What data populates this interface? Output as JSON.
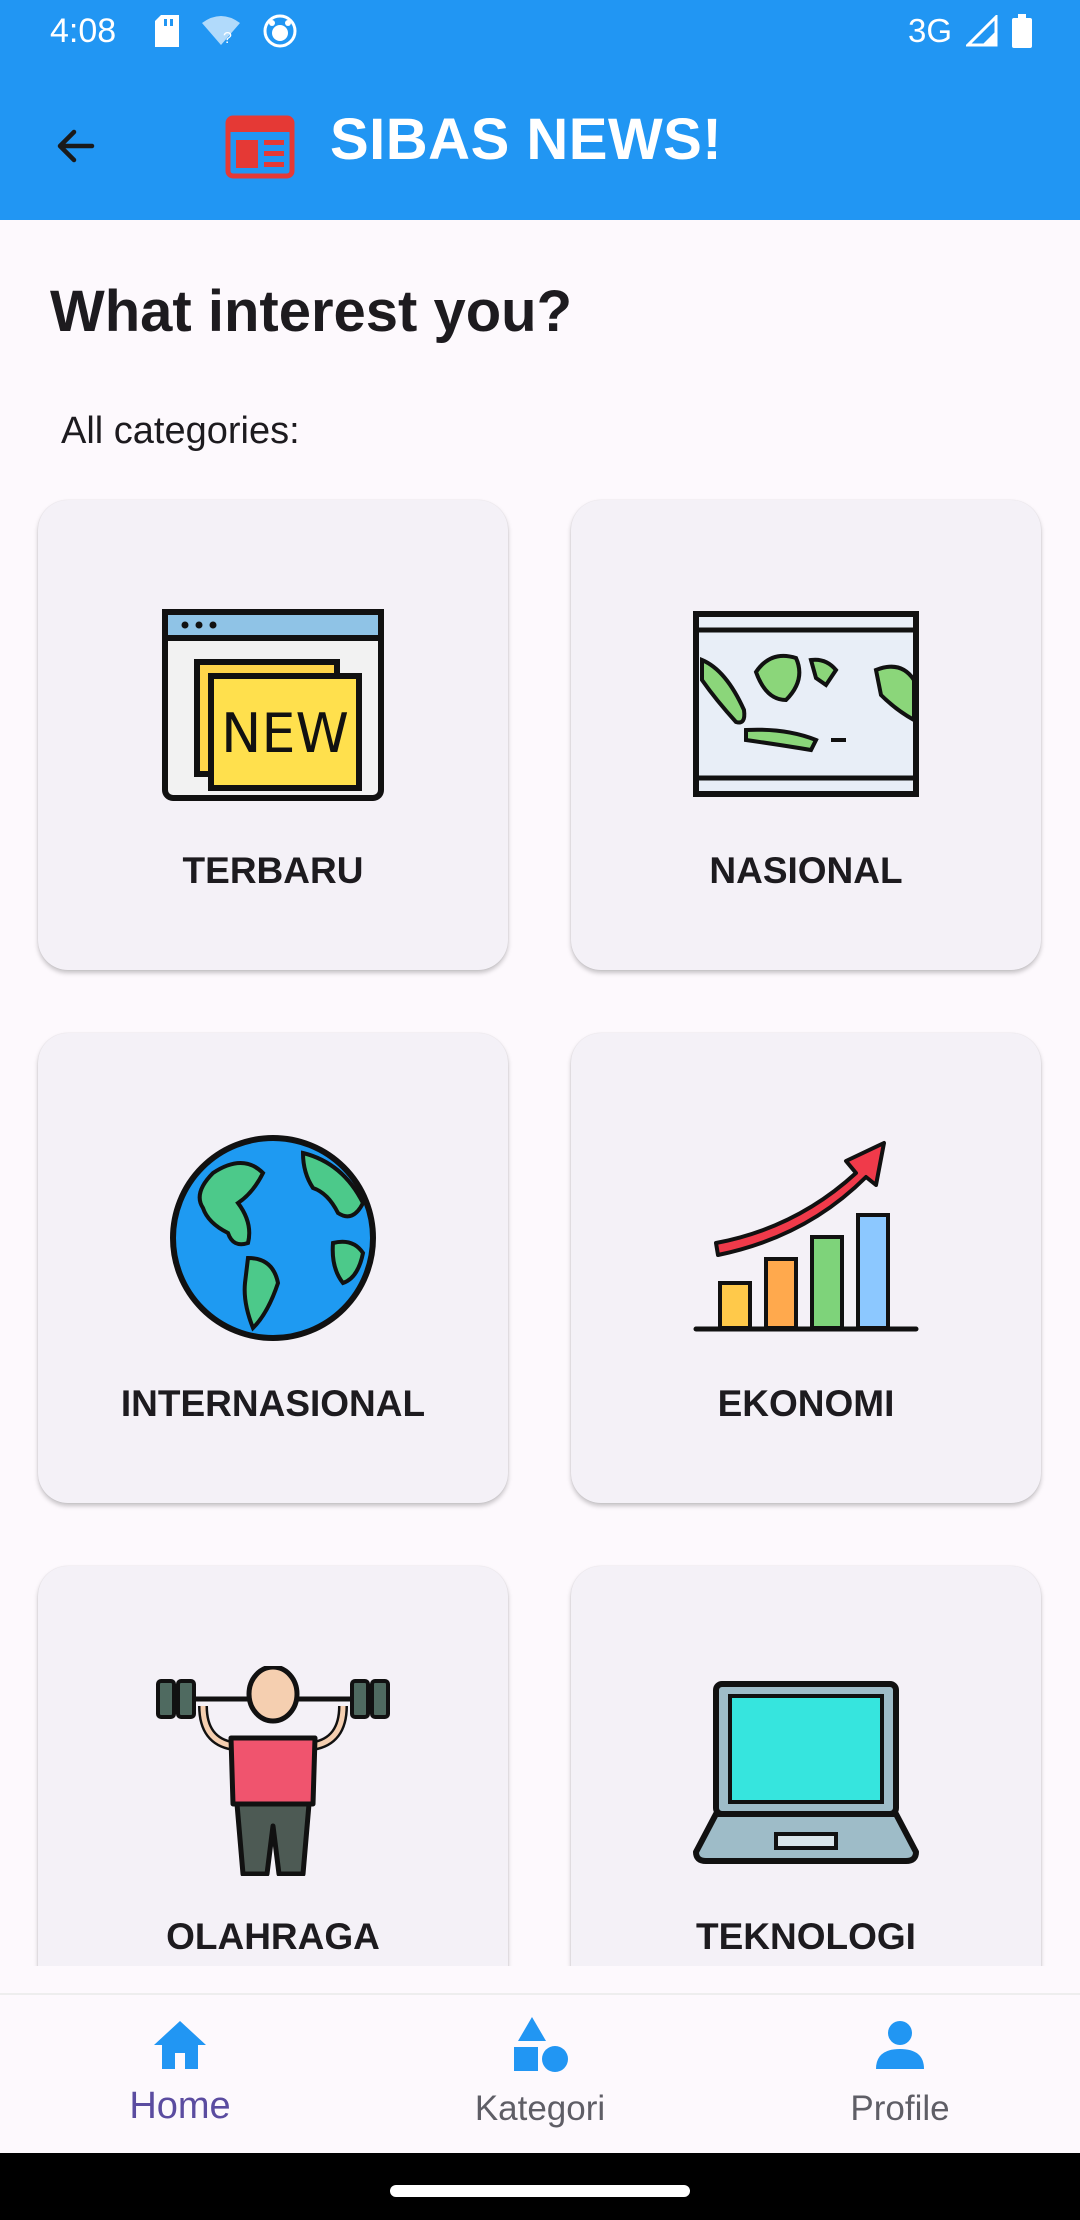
{
  "status_bar": {
    "time": "4:08",
    "network": "3G"
  },
  "app_bar": {
    "title": "SIBAS NEWS!",
    "back_icon": "arrow-left-icon",
    "logo_icon": "newspaper-icon"
  },
  "main": {
    "heading": "What interest you?",
    "subheading": "All categories:",
    "categories": [
      {
        "label": "TERBARU",
        "icon": "new-browser-icon"
      },
      {
        "label": "NASIONAL",
        "icon": "indonesia-map-icon"
      },
      {
        "label": "INTERNASIONAL",
        "icon": "globe-icon"
      },
      {
        "label": "EKONOMI",
        "icon": "growth-chart-icon"
      },
      {
        "label": "OLAHRAGA",
        "icon": "weightlifter-icon"
      },
      {
        "label": "TEKNOLOGI",
        "icon": "laptop-icon"
      }
    ]
  },
  "bottom_nav": {
    "items": [
      {
        "label": "Home",
        "icon": "home-icon",
        "active": true
      },
      {
        "label": "Kategori",
        "icon": "shapes-icon",
        "active": false
      },
      {
        "label": "Profile",
        "icon": "person-icon",
        "active": false
      }
    ]
  },
  "colors": {
    "primary": "#2196f3",
    "active_nav": "#5b4ca0",
    "card_bg": "#f4f1f7"
  }
}
